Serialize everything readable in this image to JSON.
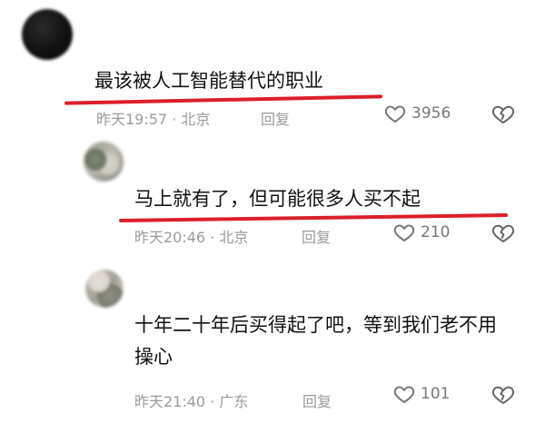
{
  "top_fragment": "",
  "comments": [
    {
      "text": "最该被人工智能替代的职业",
      "meta": "昨天19:57 · 北京",
      "reply": "回复",
      "likes": "3956",
      "username": ""
    },
    {
      "text": "马上就有了，但可能很多人买不起",
      "meta": "昨天20:46 · 北京",
      "reply": "回复",
      "likes": "210",
      "username": ""
    },
    {
      "text": "十年二十年后买得起了吧，等到我们老不用操心",
      "meta": "昨天21:40 · 广东",
      "reply": "回复",
      "likes": "101",
      "username": ""
    }
  ],
  "icons": {
    "like": "heart-outline-icon",
    "dislike": "broken-heart-icon"
  },
  "colors": {
    "text": "#111111",
    "meta": "#9b9b9b",
    "likes": "#777777",
    "highlight": "#dc1f2a"
  }
}
